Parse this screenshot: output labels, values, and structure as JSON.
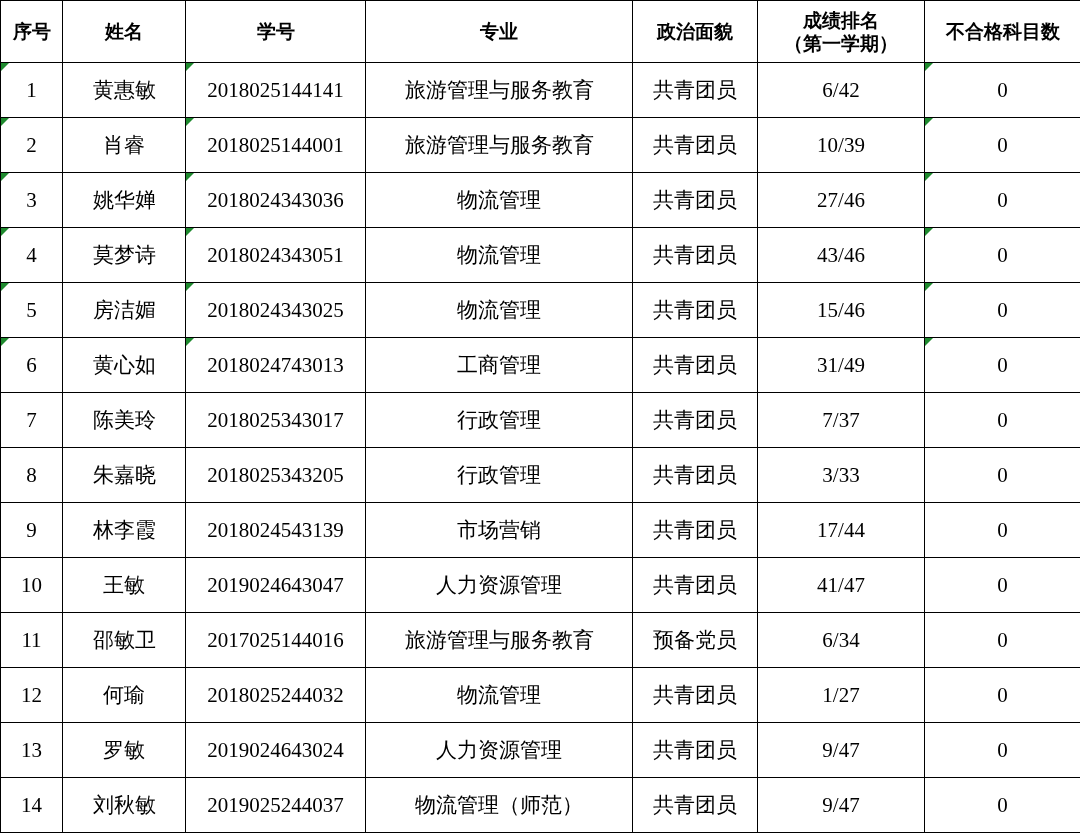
{
  "table": {
    "columns": [
      {
        "lines": [
          "序号"
        ]
      },
      {
        "lines": [
          "姓名"
        ]
      },
      {
        "lines": [
          "学号"
        ]
      },
      {
        "lines": [
          "专业"
        ]
      },
      {
        "lines": [
          "政治面貌"
        ]
      },
      {
        "lines": [
          "成绩排名",
          "（第一学期）"
        ]
      },
      {
        "lines": [
          "不合格科目数"
        ]
      }
    ],
    "rows": [
      {
        "cells": [
          {
            "text": "1",
            "marked": true
          },
          {
            "text": "黄惠敏",
            "marked": false
          },
          {
            "text": "2018025144141",
            "marked": true
          },
          {
            "text": "旅游管理与服务教育",
            "marked": false
          },
          {
            "text": "共青团员",
            "marked": false
          },
          {
            "text": "6/42",
            "marked": false
          },
          {
            "text": "0",
            "marked": true
          }
        ]
      },
      {
        "cells": [
          {
            "text": "2",
            "marked": true
          },
          {
            "text": "肖睿",
            "marked": false
          },
          {
            "text": "2018025144001",
            "marked": true
          },
          {
            "text": "旅游管理与服务教育",
            "marked": false
          },
          {
            "text": "共青团员",
            "marked": false
          },
          {
            "text": "10/39",
            "marked": false
          },
          {
            "text": "0",
            "marked": true
          }
        ]
      },
      {
        "cells": [
          {
            "text": "3",
            "marked": true
          },
          {
            "text": "姚华婵",
            "marked": false
          },
          {
            "text": "2018024343036",
            "marked": true
          },
          {
            "text": "物流管理",
            "marked": false
          },
          {
            "text": "共青团员",
            "marked": false
          },
          {
            "text": "27/46",
            "marked": false
          },
          {
            "text": "0",
            "marked": true
          }
        ]
      },
      {
        "cells": [
          {
            "text": "4",
            "marked": true
          },
          {
            "text": "莫梦诗",
            "marked": false
          },
          {
            "text": "2018024343051",
            "marked": true
          },
          {
            "text": "物流管理",
            "marked": false
          },
          {
            "text": "共青团员",
            "marked": false
          },
          {
            "text": "43/46",
            "marked": false
          },
          {
            "text": "0",
            "marked": true
          }
        ]
      },
      {
        "cells": [
          {
            "text": "5",
            "marked": true
          },
          {
            "text": "房洁媚",
            "marked": false
          },
          {
            "text": "2018024343025",
            "marked": true
          },
          {
            "text": "物流管理",
            "marked": false
          },
          {
            "text": "共青团员",
            "marked": false
          },
          {
            "text": "15/46",
            "marked": false
          },
          {
            "text": "0",
            "marked": true
          }
        ]
      },
      {
        "cells": [
          {
            "text": "6",
            "marked": true
          },
          {
            "text": "黄心如",
            "marked": false
          },
          {
            "text": "2018024743013",
            "marked": true
          },
          {
            "text": "工商管理",
            "marked": false
          },
          {
            "text": "共青团员",
            "marked": false
          },
          {
            "text": "31/49",
            "marked": false
          },
          {
            "text": "0",
            "marked": true
          }
        ]
      },
      {
        "cells": [
          {
            "text": "7",
            "marked": false
          },
          {
            "text": "陈美玲",
            "marked": false
          },
          {
            "text": "2018025343017",
            "marked": false
          },
          {
            "text": "行政管理",
            "marked": false
          },
          {
            "text": "共青团员",
            "marked": false
          },
          {
            "text": "7/37",
            "marked": false
          },
          {
            "text": "0",
            "marked": false
          }
        ]
      },
      {
        "cells": [
          {
            "text": "8",
            "marked": false
          },
          {
            "text": "朱嘉晓",
            "marked": false
          },
          {
            "text": "2018025343205",
            "marked": false
          },
          {
            "text": "行政管理",
            "marked": false
          },
          {
            "text": "共青团员",
            "marked": false
          },
          {
            "text": "3/33",
            "marked": false
          },
          {
            "text": "0",
            "marked": false
          }
        ]
      },
      {
        "cells": [
          {
            "text": "9",
            "marked": false
          },
          {
            "text": "林李霞",
            "marked": false
          },
          {
            "text": "2018024543139",
            "marked": false
          },
          {
            "text": "市场营销",
            "marked": false
          },
          {
            "text": "共青团员",
            "marked": false
          },
          {
            "text": "17/44",
            "marked": false
          },
          {
            "text": "0",
            "marked": false
          }
        ]
      },
      {
        "cells": [
          {
            "text": "10",
            "marked": false
          },
          {
            "text": "王敏",
            "marked": false
          },
          {
            "text": "2019024643047",
            "marked": false
          },
          {
            "text": "人力资源管理",
            "marked": false
          },
          {
            "text": "共青团员",
            "marked": false
          },
          {
            "text": "41/47",
            "marked": false
          },
          {
            "text": "0",
            "marked": false
          }
        ]
      },
      {
        "cells": [
          {
            "text": "11",
            "marked": false
          },
          {
            "text": "邵敏卫",
            "marked": false
          },
          {
            "text": "2017025144016",
            "marked": false
          },
          {
            "text": "旅游管理与服务教育",
            "marked": false
          },
          {
            "text": "预备党员",
            "marked": false
          },
          {
            "text": "6/34",
            "marked": false
          },
          {
            "text": "0",
            "marked": false
          }
        ]
      },
      {
        "cells": [
          {
            "text": "12",
            "marked": false
          },
          {
            "text": "何瑜",
            "marked": false
          },
          {
            "text": "2018025244032",
            "marked": false
          },
          {
            "text": "物流管理",
            "marked": false
          },
          {
            "text": "共青团员",
            "marked": false
          },
          {
            "text": "1/27",
            "marked": false
          },
          {
            "text": "0",
            "marked": false
          }
        ]
      },
      {
        "cells": [
          {
            "text": "13",
            "marked": false
          },
          {
            "text": "罗敏",
            "marked": false
          },
          {
            "text": "2019024643024",
            "marked": false
          },
          {
            "text": "人力资源管理",
            "marked": false
          },
          {
            "text": "共青团员",
            "marked": false
          },
          {
            "text": "9/47",
            "marked": false
          },
          {
            "text": "0",
            "marked": false
          }
        ]
      },
      {
        "cells": [
          {
            "text": "14",
            "marked": false
          },
          {
            "text": "刘秋敏",
            "marked": false
          },
          {
            "text": "2019025244037",
            "marked": false
          },
          {
            "text": "物流管理（师范）",
            "marked": false
          },
          {
            "text": "共青团员",
            "marked": false
          },
          {
            "text": "9/47",
            "marked": false
          },
          {
            "text": "0",
            "marked": false
          }
        ]
      }
    ]
  }
}
